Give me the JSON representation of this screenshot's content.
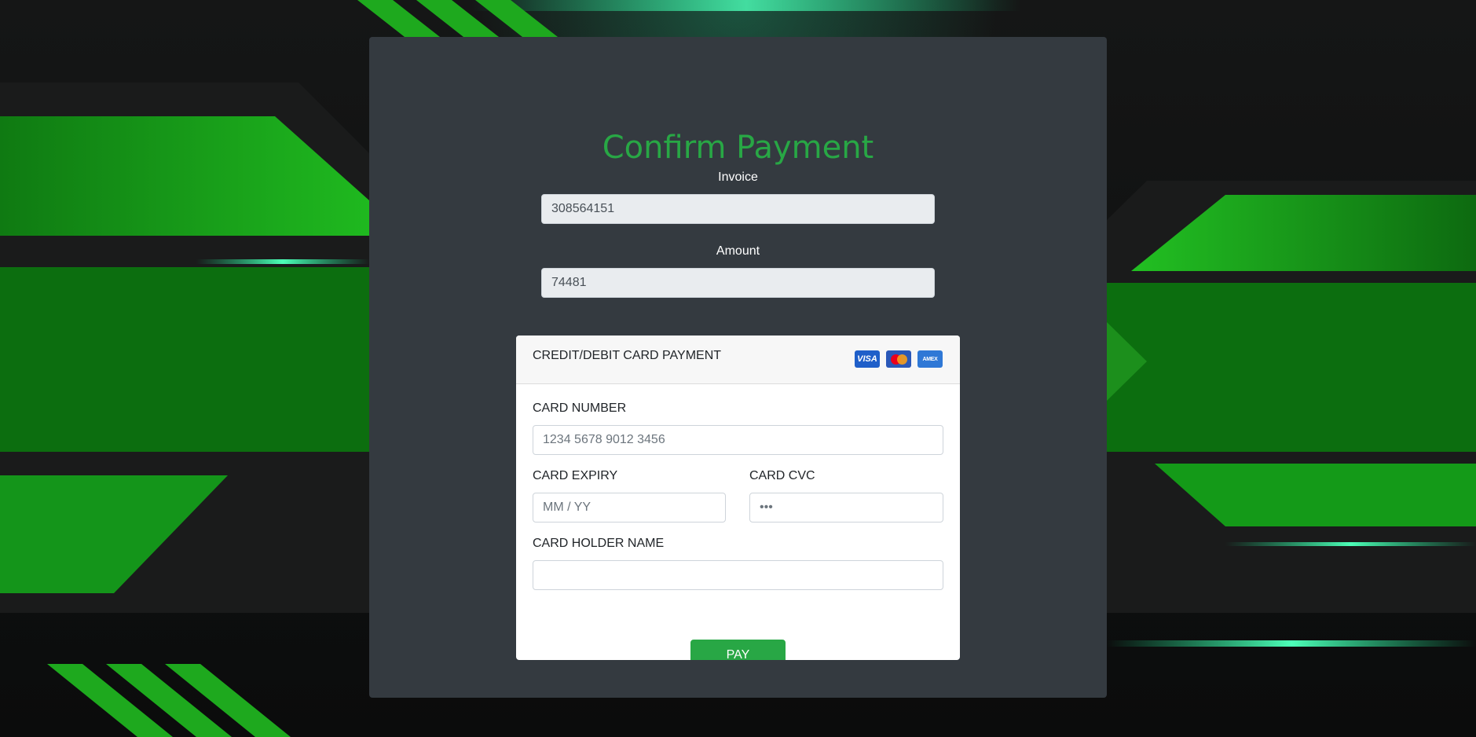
{
  "page": {
    "title": "Confirm Payment"
  },
  "invoice": {
    "label": "Invoice",
    "value": "308564151"
  },
  "amount": {
    "label": "Amount",
    "value": "74481"
  },
  "card": {
    "header": "CREDIT/DEBIT CARD PAYMENT",
    "brands": {
      "visa": "VISA",
      "amex": "AMEX"
    },
    "number_label": "CARD NUMBER",
    "number_placeholder": "1234 5678 9012 3456",
    "expiry_label": "CARD EXPIRY",
    "expiry_placeholder": "MM / YY",
    "cvc_label": "CARD CVC",
    "cvc_placeholder": "•••",
    "holder_label": "CARD HOLDER NAME",
    "holder_placeholder": "",
    "pay_label": "PAY"
  },
  "colors": {
    "accent": "#28a745",
    "panel": "#343a40",
    "background_glow": "#1fc21f"
  }
}
